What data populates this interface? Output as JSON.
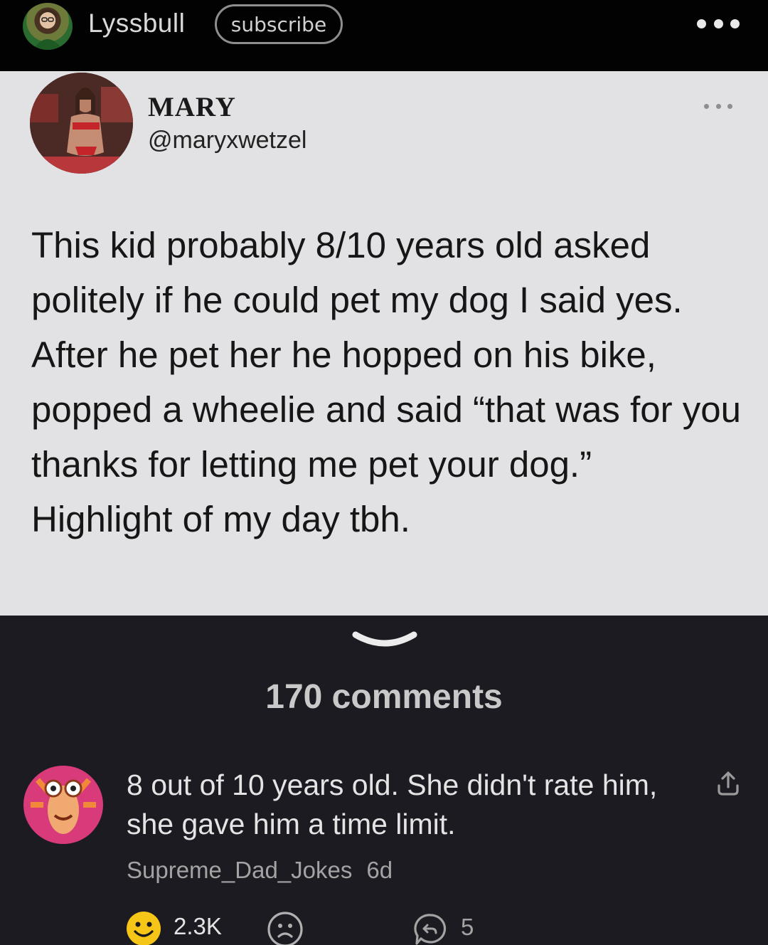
{
  "header": {
    "username": "Lyssbull",
    "subscribe_label": "subscribe",
    "more_icon": "ellipsis-icon"
  },
  "tweet": {
    "display_name": "MARY",
    "handle": "@maryxwetzel",
    "text": "This kid probably 8/10 years old asked politely if he could pet my dog I said yes. After he pet her he hopped on his bike, popped a wheelie and said “that was for you thanks for letting me pet your dog.” Highlight of my day tbh."
  },
  "comments": {
    "count_label": "170 comments"
  },
  "comment": {
    "text": "8 out of 10 years old. She didn't rate him, she gave him a time limit.",
    "author": "Supreme_Dad_Jokes",
    "age": "6d",
    "upvotes": "2.3K",
    "replies": "5"
  },
  "colors": {
    "background": "#1c1b21",
    "topbar": "#020202",
    "tweet_card": "#e2e2e4",
    "smile_yellow": "#f5c518"
  }
}
